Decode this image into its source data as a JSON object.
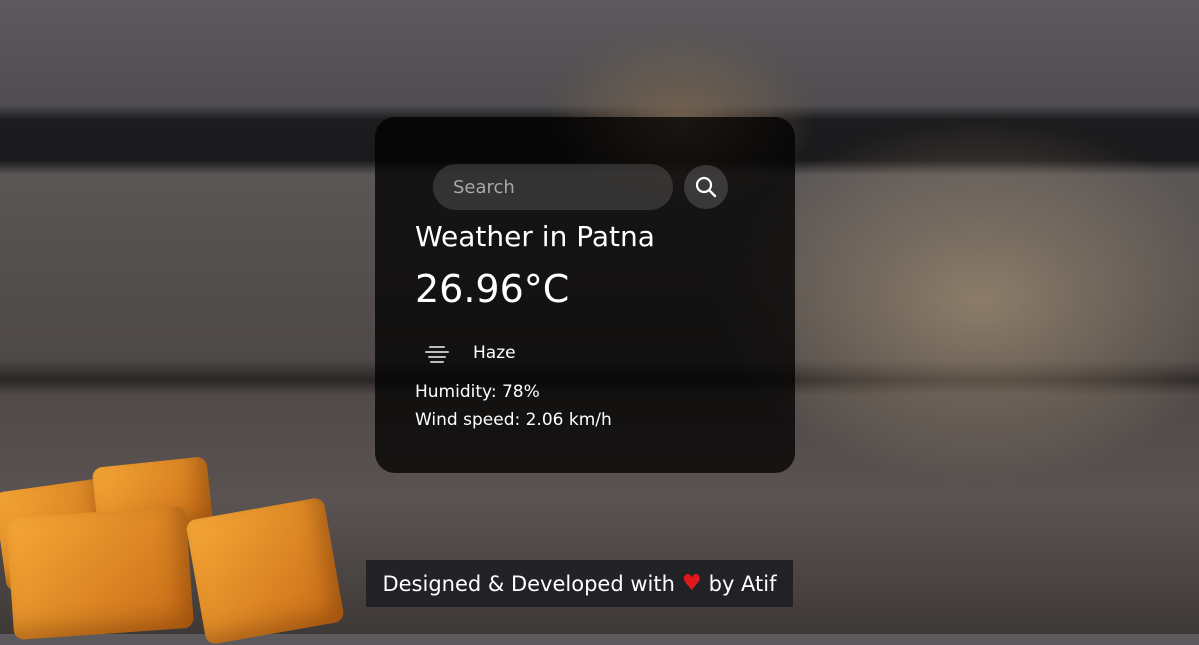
{
  "search": {
    "placeholder": "Search"
  },
  "weather": {
    "title": "Weather in Patna",
    "temperature": "26.96°C",
    "condition": "Haze",
    "condition_icon": "haze-icon",
    "humidity": "Humidity: 78%",
    "wind": "Wind speed: 2.06 km/h"
  },
  "footer": {
    "text_before": "Designed & Developed with",
    "text_after": "by Atif",
    "heart_color": "#e0191d"
  }
}
